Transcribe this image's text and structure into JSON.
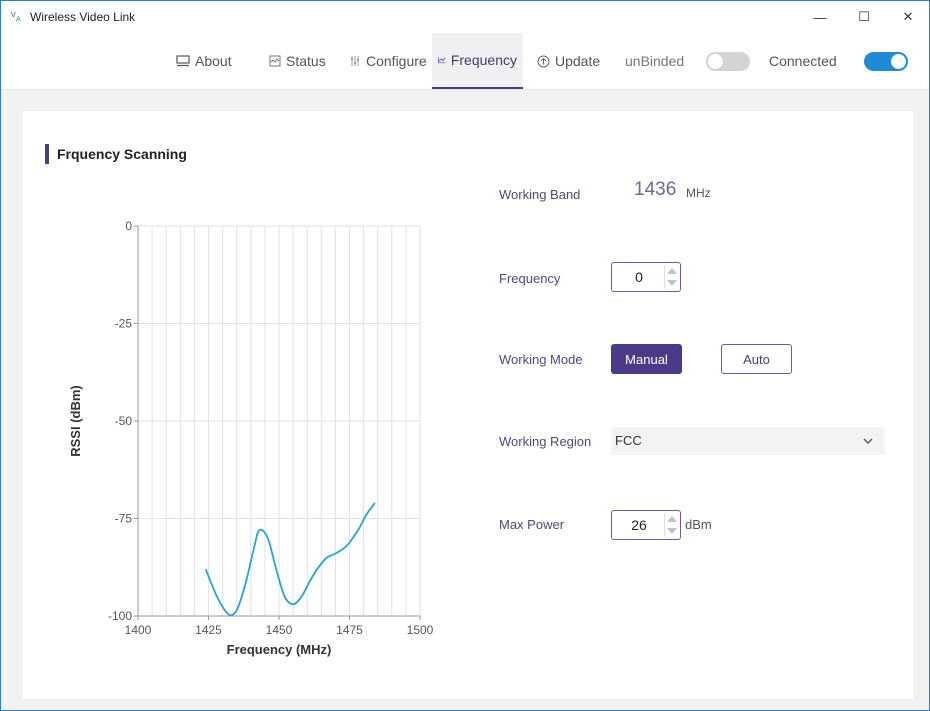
{
  "window": {
    "title": "Wireless Video Link",
    "controls": {
      "minimize": "—",
      "maximize": "☐",
      "close": "✕"
    }
  },
  "nav": {
    "tabs": [
      {
        "label": "About",
        "icon": "monitor-icon"
      },
      {
        "label": "Status",
        "icon": "status-icon"
      },
      {
        "label": "Configure",
        "icon": "sliders-icon"
      },
      {
        "label": "Frequency",
        "icon": "line-chart-icon",
        "active": true
      },
      {
        "label": "Update",
        "icon": "upload-circle-icon"
      }
    ],
    "bind_label": "unBinded",
    "bind_on": false,
    "connection_label": "Connected",
    "connection_on": true
  },
  "section": {
    "title": "Frquency Scanning"
  },
  "settings": {
    "working_band": {
      "label": "Working Band",
      "value": "1436",
      "unit": "MHz"
    },
    "frequency": {
      "label": "Frequency",
      "value": "0"
    },
    "working_mode": {
      "label": "Working Mode",
      "options": [
        "Manual",
        "Auto"
      ],
      "selected": "Manual"
    },
    "working_region": {
      "label": "Working Region",
      "value": "FCC"
    },
    "max_power": {
      "label": "Max Power",
      "value": "26",
      "unit": "dBm"
    }
  },
  "colors": {
    "accent": "#4b3a8a",
    "toggle_on": "#1f8ad8",
    "series": "#26a5cf"
  },
  "chart_data": {
    "type": "line",
    "xlabel": "Frequency (MHz)",
    "ylabel": "RSSI (dBm)",
    "xlim": [
      1400,
      1500
    ],
    "ylim": [
      -100,
      0
    ],
    "xticks": [
      1400,
      1425,
      1450,
      1475,
      1500
    ],
    "yticks": [
      0,
      -25,
      -50,
      -75,
      -100
    ],
    "grid": true,
    "series": [
      {
        "x": [
          1424,
          1428,
          1432,
          1435,
          1438,
          1441,
          1443,
          1446,
          1449,
          1452,
          1455,
          1458,
          1461,
          1464,
          1467,
          1470,
          1474,
          1478,
          1481,
          1484
        ],
        "values": [
          -88,
          -95,
          -99.5,
          -98.5,
          -92,
          -83,
          -78,
          -80,
          -88,
          -95,
          -97,
          -95,
          -91,
          -87.5,
          -85,
          -84,
          -82,
          -78,
          -74,
          -71
        ]
      }
    ]
  }
}
